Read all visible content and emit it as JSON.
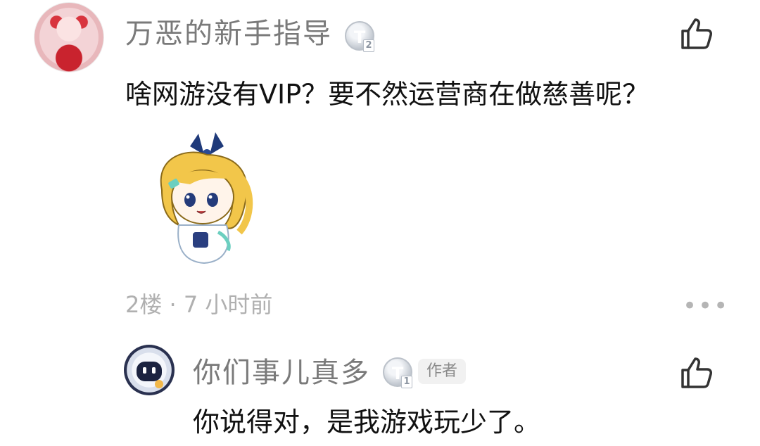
{
  "comments": [
    {
      "username": "万恶的新手指导",
      "level_letter": "T",
      "level_num": "2",
      "text": "啥网游没有VIP？要不然运营商在做慈善呢？",
      "floor_info": "2楼 · 7 小时前",
      "sticker": "anime-girl-sticker"
    },
    {
      "username": "你们事儿真多",
      "level_letter": "T",
      "level_num": "1",
      "tag": "作者",
      "text": "你说得对，是我游戏玩少了。"
    }
  ],
  "icons": {
    "like": "thumbs-up-icon",
    "more": "more-dots-icon"
  },
  "more_label": "•••"
}
